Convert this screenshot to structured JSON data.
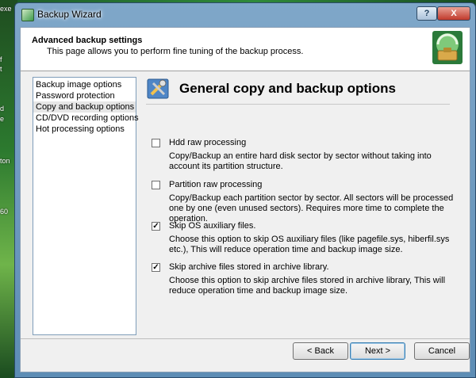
{
  "desktop": {
    "fragments": [
      "exe",
      "f",
      "t",
      "d",
      "e",
      "ton",
      "60"
    ]
  },
  "window": {
    "title": "Backup Wizard",
    "help_label": "?",
    "close_label": "X"
  },
  "header": {
    "title": "Advanced backup settings",
    "subtitle": "This page allows you to perform fine tuning of the backup process."
  },
  "nav": {
    "items": [
      {
        "label": "Backup image options"
      },
      {
        "label": "Password protection"
      },
      {
        "label": "Copy and backup options",
        "selected": true
      },
      {
        "label": "CD/DVD recording options"
      },
      {
        "label": "Hot processing options"
      }
    ]
  },
  "section": {
    "title": "General copy and backup options",
    "options": [
      {
        "label": "Hdd raw processing",
        "checked": false,
        "description": "Copy/Backup an entire hard disk sector by sector without taking into account its partition structure."
      },
      {
        "label": "Partition raw processing",
        "checked": false,
        "description": "Copy/Backup each partition sector by sector. All sectors will be processed one by one (even unused sectors). Requires more time to complete the operation."
      },
      {
        "label": "Skip OS auxiliary files.",
        "checked": true,
        "description": "Choose this option to skip OS auxiliary files (like pagefile.sys, hiberfil.sys etc.), This will reduce operation time and backup image size."
      },
      {
        "label": "Skip archive files stored in archive library.",
        "checked": true,
        "description": "Choose this option to skip archive files stored in archive library, This will reduce operation time and backup image size."
      }
    ]
  },
  "buttons": {
    "back": "< Back",
    "next": "Next >",
    "cancel": "Cancel"
  }
}
